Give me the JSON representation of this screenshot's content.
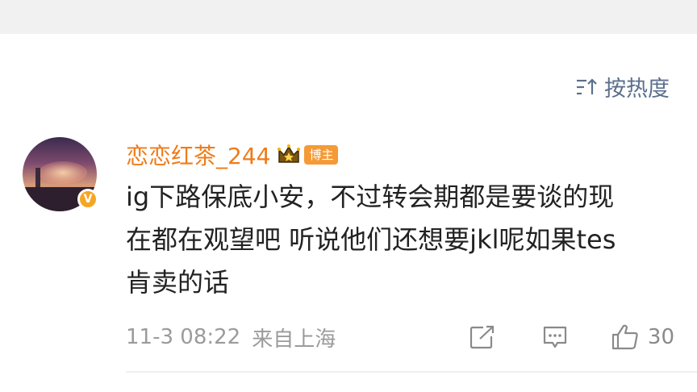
{
  "sort": {
    "icon": "sort-icon",
    "label": "按热度"
  },
  "comment": {
    "avatar_icon": "avatar-sunset-city",
    "verified_icon": "verified-badge-icon",
    "username": "恋恋红茶_244",
    "crown_icon": "crown-icon",
    "role_badge": "博主",
    "text": "ig下路保底小安，不过转会期都是要谈的现\n在都在观望吧 听说他们还想要jkl呢如果tes\n肯卖的话",
    "time": "11-3 08:22",
    "origin": "来自上海",
    "actions": {
      "share_icon": "share-icon",
      "comment_icon": "comment-icon",
      "like_icon": "thumbs-up-icon",
      "like_count": "30"
    }
  },
  "colors": {
    "username": "#ef7b1a",
    "badge": "#f59a35",
    "sort": "#5b6f8c",
    "meta": "#9b9b9b",
    "top_band": "#f1f1f1"
  }
}
